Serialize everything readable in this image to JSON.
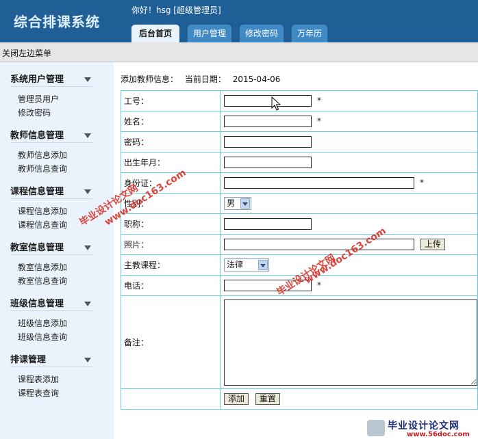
{
  "header": {
    "app_title": "综合排课系统",
    "greeting": "你好！hsg [超级管理员]",
    "tabs": [
      {
        "label": "后台首页",
        "active": true
      },
      {
        "label": "用户管理",
        "active": false
      },
      {
        "label": "修改密码",
        "active": false
      },
      {
        "label": "万年历",
        "active": false
      }
    ]
  },
  "subbar": {
    "close_menu": "关闭左边菜单"
  },
  "sidebar": {
    "groups": [
      {
        "title": "系统用户管理",
        "items": [
          "管理员用户",
          "修改密码"
        ]
      },
      {
        "title": "教师信息管理",
        "items": [
          "教师信息添加",
          "教师信息查询"
        ]
      },
      {
        "title": "课程信息管理",
        "items": [
          "课程信息添加",
          "课程信息查询"
        ]
      },
      {
        "title": "教室信息管理",
        "items": [
          "教室信息添加",
          "教室信息查询"
        ]
      },
      {
        "title": "班级信息管理",
        "items": [
          "班级信息添加",
          "班级信息查询"
        ]
      },
      {
        "title": "排课管理",
        "items": [
          "课程表添加",
          "课程表查询"
        ]
      }
    ]
  },
  "main": {
    "caption": "添加教师信息：",
    "date_label": "当前日期：",
    "date_value": "2015-04-06",
    "form": {
      "fields": [
        {
          "label": "工号：",
          "type": "text",
          "value": "",
          "required": true
        },
        {
          "label": "姓名：",
          "type": "text",
          "value": "",
          "required": true
        },
        {
          "label": "密码：",
          "type": "text",
          "value": "",
          "required": false
        },
        {
          "label": "出生年月：",
          "type": "text",
          "value": "",
          "required": false
        },
        {
          "label": "身份证：",
          "type": "text",
          "value": "",
          "required": true
        },
        {
          "label": "性别：",
          "type": "select",
          "value": "男"
        },
        {
          "label": "职称：",
          "type": "text",
          "value": "",
          "required": false
        },
        {
          "label": "照片：",
          "type": "file",
          "value": "",
          "button": "上传"
        },
        {
          "label": "主教课程：",
          "type": "select",
          "value": "法律"
        },
        {
          "label": "电话：",
          "type": "text",
          "value": "",
          "required": true
        },
        {
          "label": "备注：",
          "type": "textarea",
          "value": ""
        }
      ],
      "required_mark": "*",
      "submit_label": "添加",
      "reset_label": "重置"
    }
  },
  "watermarks": {
    "site_name": "毕业设计论文网",
    "site_url": "www.doc163.com",
    "color": "#d9352c"
  },
  "footer_logo": {
    "name": "毕业设计论文网",
    "url": "www.56doc.com"
  }
}
